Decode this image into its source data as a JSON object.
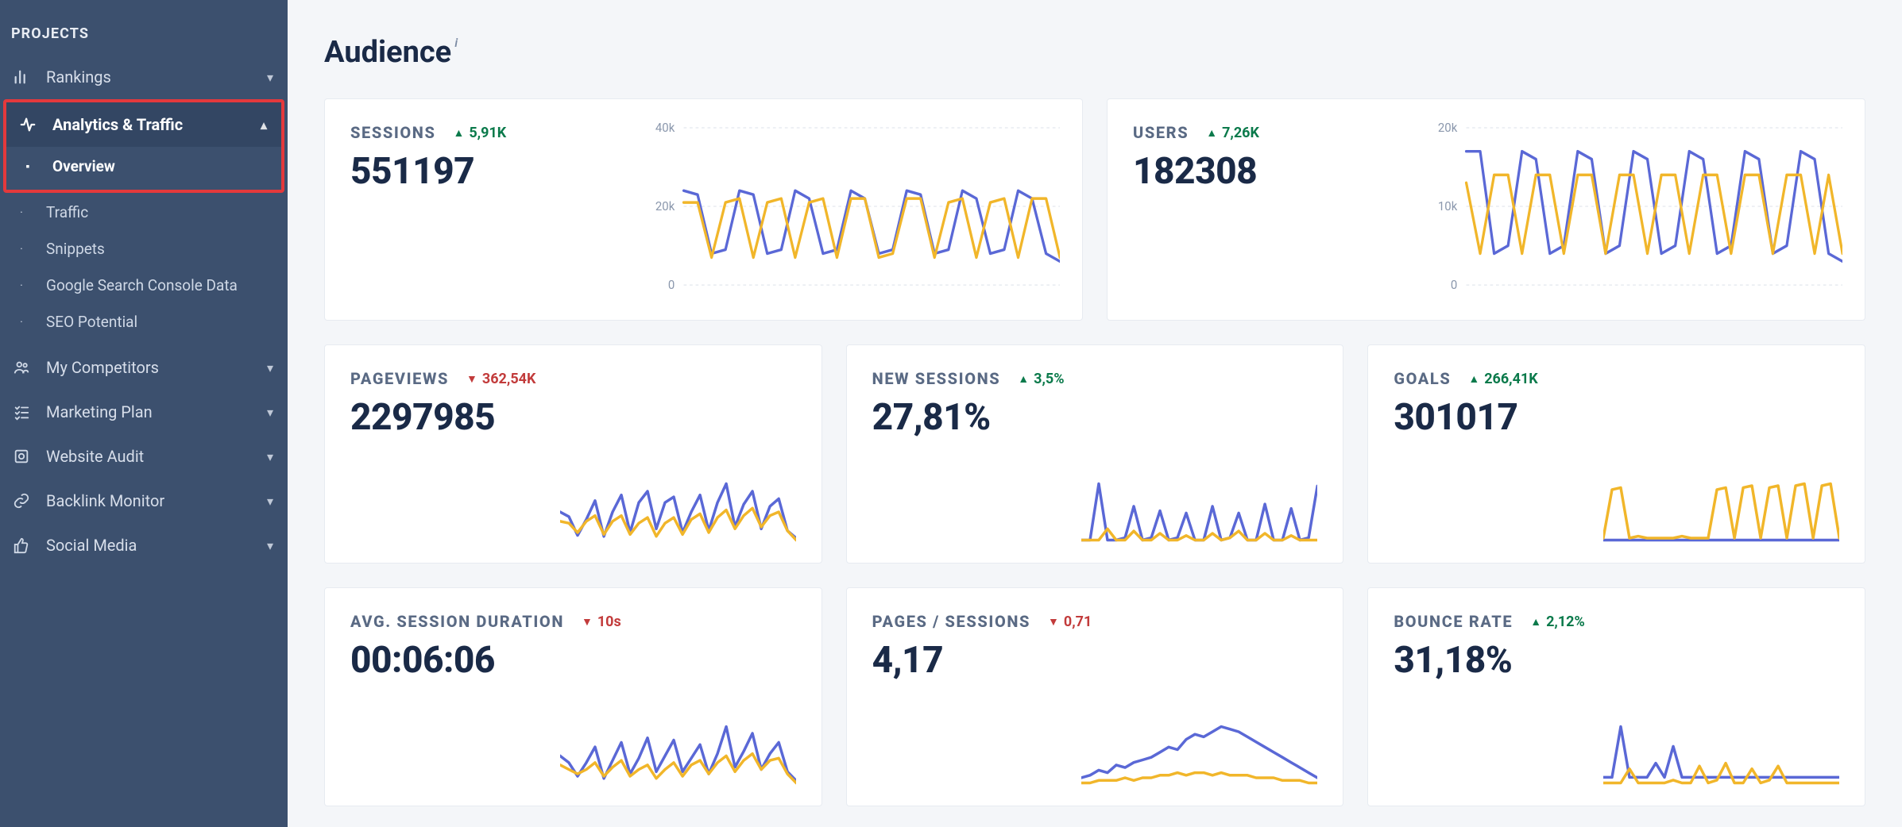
{
  "sidebar": {
    "section_label": "PROJECTS",
    "items": [
      {
        "label": "Rankings",
        "icon": "bars",
        "expandable": true,
        "expanded": false
      },
      {
        "label": "Analytics & Traffic",
        "icon": "activity",
        "expandable": true,
        "expanded": true,
        "children": [
          {
            "label": "Overview",
            "active": true
          },
          {
            "label": "Traffic"
          },
          {
            "label": "Snippets"
          },
          {
            "label": "Google Search Console Data"
          },
          {
            "label": "SEO Potential"
          }
        ]
      },
      {
        "label": "My Competitors",
        "icon": "people",
        "expandable": true
      },
      {
        "label": "Marketing Plan",
        "icon": "checklist",
        "expandable": true
      },
      {
        "label": "Website Audit",
        "icon": "audit",
        "expandable": true
      },
      {
        "label": "Backlink Monitor",
        "icon": "link",
        "expandable": true
      },
      {
        "label": "Social Media",
        "icon": "thumb",
        "expandable": true
      }
    ]
  },
  "page": {
    "title": "Audience",
    "info_glyph": "i"
  },
  "colors": {
    "series_a": "#5a68d6",
    "series_b": "#f1b62a",
    "delta_up": "#0b7a4b",
    "delta_down": "#c23b3b"
  },
  "cards": {
    "sessions": {
      "label": "SESSIONS",
      "delta": "5,91K",
      "delta_dir": "up",
      "value": "551197",
      "axis": [
        "40k",
        "20k",
        "0"
      ]
    },
    "users": {
      "label": "USERS",
      "delta": "7,26K",
      "delta_dir": "up",
      "value": "182308",
      "axis": [
        "20k",
        "10k",
        "0"
      ]
    },
    "pageviews": {
      "label": "PAGEVIEWS",
      "delta": "362,54K",
      "delta_dir": "down",
      "value": "2297985"
    },
    "new_sessions": {
      "label": "NEW SESSIONS",
      "delta": "3,5%",
      "delta_dir": "up",
      "value": "27,81%"
    },
    "goals": {
      "label": "GOALS",
      "delta": "266,41K",
      "delta_dir": "up",
      "value": "301017"
    },
    "avg_duration": {
      "label": "AVG. SESSION DURATION",
      "delta": "10s",
      "delta_dir": "down",
      "value": "00:06:06"
    },
    "pages_sessions": {
      "label": "PAGES / SESSIONS",
      "delta": "0,71",
      "delta_dir": "down",
      "value": "4,17"
    },
    "bounce_rate": {
      "label": "BOUNCE RATE",
      "delta": "2,12%",
      "delta_dir": "up",
      "value": "31,18%"
    }
  },
  "chart_data": [
    {
      "id": "sessions",
      "type": "line",
      "ylabel": "",
      "xlabel": "",
      "ylim": [
        0,
        40000
      ],
      "yticks": [
        0,
        20000,
        40000
      ],
      "ytick_labels": [
        "0",
        "20k",
        "40k"
      ],
      "series": [
        {
          "name": "current",
          "color": "#5a68d6",
          "values": [
            24000,
            23000,
            8000,
            9000,
            24000,
            23000,
            8000,
            9000,
            24000,
            22000,
            8000,
            9000,
            24000,
            22000,
            8000,
            9000,
            24000,
            23000,
            8000,
            9000,
            24000,
            22000,
            8000,
            9000,
            24000,
            22000,
            8000,
            6000
          ]
        },
        {
          "name": "previous",
          "color": "#f1b62a",
          "values": [
            21000,
            21000,
            7000,
            21000,
            22000,
            7000,
            21000,
            22000,
            7000,
            21000,
            22000,
            7000,
            22000,
            22000,
            7000,
            8000,
            22000,
            22000,
            7000,
            21000,
            22000,
            7000,
            21000,
            22000,
            7000,
            22000,
            22000,
            7000
          ]
        }
      ]
    },
    {
      "id": "users",
      "type": "line",
      "ylim": [
        0,
        20000
      ],
      "yticks": [
        0,
        10000,
        20000
      ],
      "ytick_labels": [
        "0",
        "10k",
        "20k"
      ],
      "series": [
        {
          "name": "current",
          "color": "#5a68d6",
          "values": [
            17000,
            17000,
            4000,
            5000,
            17000,
            16000,
            4000,
            5000,
            17000,
            16000,
            4000,
            5000,
            17000,
            16000,
            4000,
            5000,
            17000,
            16000,
            4000,
            5000,
            17000,
            16000,
            4000,
            5000,
            17000,
            16000,
            4000,
            3000
          ]
        },
        {
          "name": "previous",
          "color": "#f1b62a",
          "values": [
            13000,
            4000,
            14000,
            14000,
            4000,
            14000,
            14000,
            4000,
            14000,
            14000,
            4000,
            14000,
            14000,
            4000,
            14000,
            14000,
            4000,
            14000,
            14000,
            4000,
            14000,
            14000,
            4000,
            14000,
            14000,
            4000,
            14000,
            4000
          ]
        }
      ]
    },
    {
      "id": "pageviews",
      "type": "line",
      "series": [
        {
          "name": "current",
          "color": "#5a68d6",
          "values": [
            60,
            55,
            35,
            52,
            72,
            34,
            60,
            78,
            38,
            70,
            82,
            42,
            70,
            76,
            38,
            60,
            78,
            40,
            70,
            90,
            44,
            68,
            82,
            42,
            66,
            74,
            40,
            32
          ]
        },
        {
          "name": "previous",
          "color": "#f1b62a",
          "values": [
            50,
            48,
            38,
            50,
            56,
            36,
            50,
            56,
            36,
            48,
            54,
            34,
            48,
            54,
            36,
            52,
            58,
            38,
            54,
            62,
            42,
            56,
            64,
            44,
            56,
            60,
            40,
            30
          ]
        }
      ]
    },
    {
      "id": "new_sessions",
      "type": "line",
      "series": [
        {
          "name": "current",
          "color": "#5a68d6",
          "values": [
            30,
            30,
            80,
            30,
            30,
            32,
            60,
            30,
            32,
            56,
            30,
            32,
            54,
            30,
            30,
            60,
            30,
            32,
            54,
            30,
            30,
            62,
            30,
            30,
            58,
            30,
            32,
            78
          ]
        },
        {
          "name": "previous",
          "color": "#f1b62a",
          "values": [
            30,
            30,
            30,
            40,
            30,
            30,
            38,
            30,
            30,
            36,
            30,
            30,
            34,
            30,
            30,
            36,
            30,
            32,
            38,
            30,
            30,
            36,
            30,
            30,
            34,
            30,
            30,
            30
          ]
        }
      ]
    },
    {
      "id": "goals",
      "type": "line",
      "series": [
        {
          "name": "current",
          "color": "#5a68d6",
          "values": [
            20,
            20,
            20,
            20,
            20,
            20,
            20,
            20,
            20,
            20,
            20,
            20,
            20,
            20,
            20,
            20,
            20,
            20,
            20,
            20,
            20,
            20,
            20,
            20,
            20,
            20,
            20,
            20
          ]
        },
        {
          "name": "previous",
          "color": "#f1b62a",
          "values": [
            22,
            72,
            74,
            22,
            24,
            22,
            22,
            22,
            22,
            24,
            22,
            22,
            22,
            72,
            74,
            22,
            74,
            76,
            22,
            74,
            76,
            22,
            76,
            78,
            22,
            76,
            78,
            22
          ]
        }
      ]
    },
    {
      "id": "avg_duration",
      "type": "line",
      "series": [
        {
          "name": "current",
          "color": "#5a68d6",
          "values": [
            54,
            48,
            36,
            48,
            62,
            34,
            50,
            66,
            38,
            52,
            70,
            40,
            54,
            68,
            40,
            52,
            64,
            38,
            56,
            80,
            44,
            58,
            74,
            42,
            56,
            66,
            40,
            32
          ]
        },
        {
          "name": "previous",
          "color": "#f1b62a",
          "values": [
            46,
            42,
            38,
            42,
            48,
            36,
            44,
            50,
            36,
            42,
            46,
            34,
            42,
            48,
            36,
            46,
            50,
            38,
            48,
            54,
            40,
            50,
            56,
            42,
            50,
            52,
            38,
            30
          ]
        }
      ]
    },
    {
      "id": "pages_sessions",
      "type": "line",
      "series": [
        {
          "name": "current",
          "color": "#5a68d6",
          "values": [
            38,
            40,
            44,
            42,
            48,
            46,
            50,
            52,
            54,
            58,
            62,
            60,
            68,
            72,
            70,
            74,
            78,
            76,
            74,
            70,
            66,
            62,
            58,
            54,
            50,
            46,
            42,
            38
          ]
        },
        {
          "name": "previous",
          "color": "#f1b62a",
          "values": [
            34,
            34,
            36,
            36,
            36,
            38,
            36,
            38,
            38,
            40,
            40,
            42,
            40,
            42,
            42,
            40,
            42,
            40,
            40,
            40,
            38,
            38,
            38,
            36,
            36,
            36,
            34,
            34
          ]
        }
      ]
    },
    {
      "id": "bounce_rate",
      "type": "line",
      "series": [
        {
          "name": "current",
          "color": "#5a68d6",
          "values": [
            44,
            44,
            80,
            44,
            44,
            44,
            54,
            44,
            66,
            44,
            44,
            44,
            44,
            44,
            44,
            44,
            44,
            44,
            44,
            44,
            44,
            44,
            44,
            44,
            44,
            44,
            44,
            44
          ]
        },
        {
          "name": "previous",
          "color": "#f1b62a",
          "values": [
            40,
            40,
            40,
            50,
            40,
            40,
            40,
            40,
            42,
            40,
            40,
            52,
            40,
            42,
            54,
            40,
            40,
            50,
            40,
            42,
            52,
            40,
            40,
            40,
            40,
            40,
            40,
            40
          ]
        }
      ]
    }
  ]
}
